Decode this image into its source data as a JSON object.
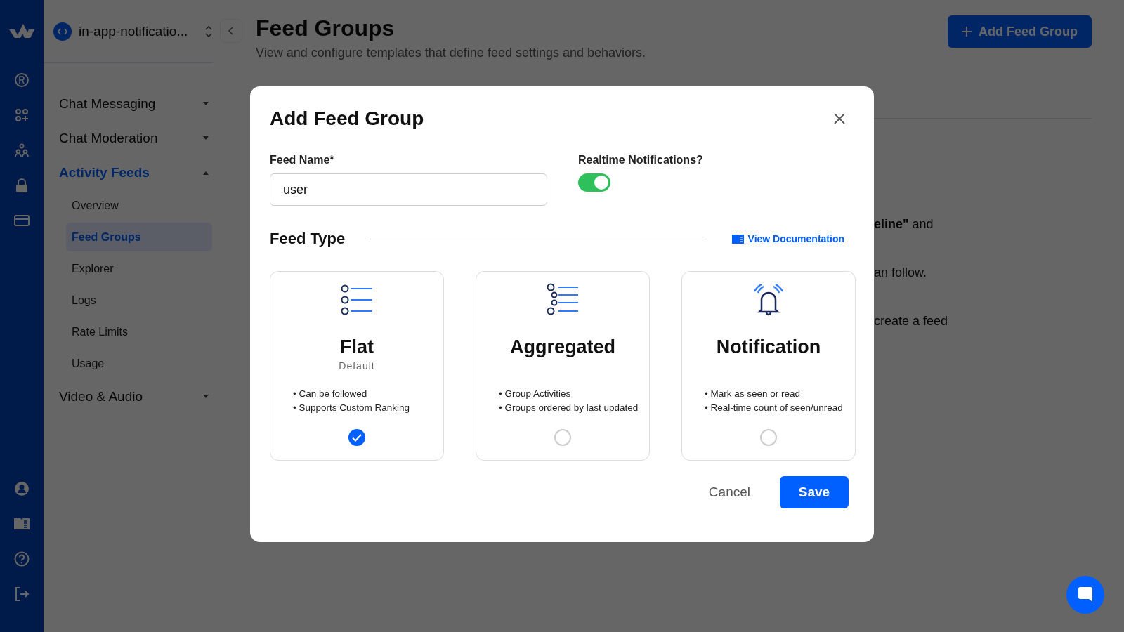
{
  "app_selector": {
    "name": "in-app-notificatio..."
  },
  "nav": [
    {
      "label": "Chat Messaging",
      "expanded": false
    },
    {
      "label": "Chat Moderation",
      "expanded": false
    },
    {
      "label": "Activity Feeds",
      "expanded": true,
      "children": [
        {
          "label": "Overview",
          "selected": false
        },
        {
          "label": "Feed Groups",
          "selected": true
        },
        {
          "label": "Explorer",
          "selected": false
        },
        {
          "label": "Logs",
          "selected": false
        },
        {
          "label": "Rate Limits",
          "selected": false
        },
        {
          "label": "Usage",
          "selected": false
        }
      ]
    },
    {
      "label": "Video & Audio",
      "expanded": false
    }
  ],
  "page": {
    "title": "Feed Groups",
    "subtitle": "View and configure templates that define feed settings and behaviors.",
    "add_button": "Add Feed Group",
    "background_text": [
      "**eline\"** and",
      "an follow.",
      "create a feed"
    ]
  },
  "dialog": {
    "title": "Add Feed Group",
    "feed_name_label": "Feed Name*",
    "feed_name_value": "user",
    "realtime_label": "Realtime Notifications?",
    "realtime_on": true,
    "section_title": "Feed Type",
    "doc_link": "View Documentation",
    "types": [
      {
        "kind": "flat",
        "title": "Flat",
        "subtitle": "Default",
        "bullets": [
          "• Can be followed",
          "• Supports Custom Ranking"
        ],
        "selected": true
      },
      {
        "kind": "aggregated",
        "title": "Aggregated",
        "bullets": [
          "• Group Activities",
          "• Groups ordered by last updated"
        ],
        "selected": false
      },
      {
        "kind": "notification",
        "title": "Notification",
        "bullets": [
          "• Mark as seen or read",
          "• Real-time count of seen/unread"
        ],
        "selected": false
      }
    ],
    "cancel": "Cancel",
    "save": "Save"
  }
}
